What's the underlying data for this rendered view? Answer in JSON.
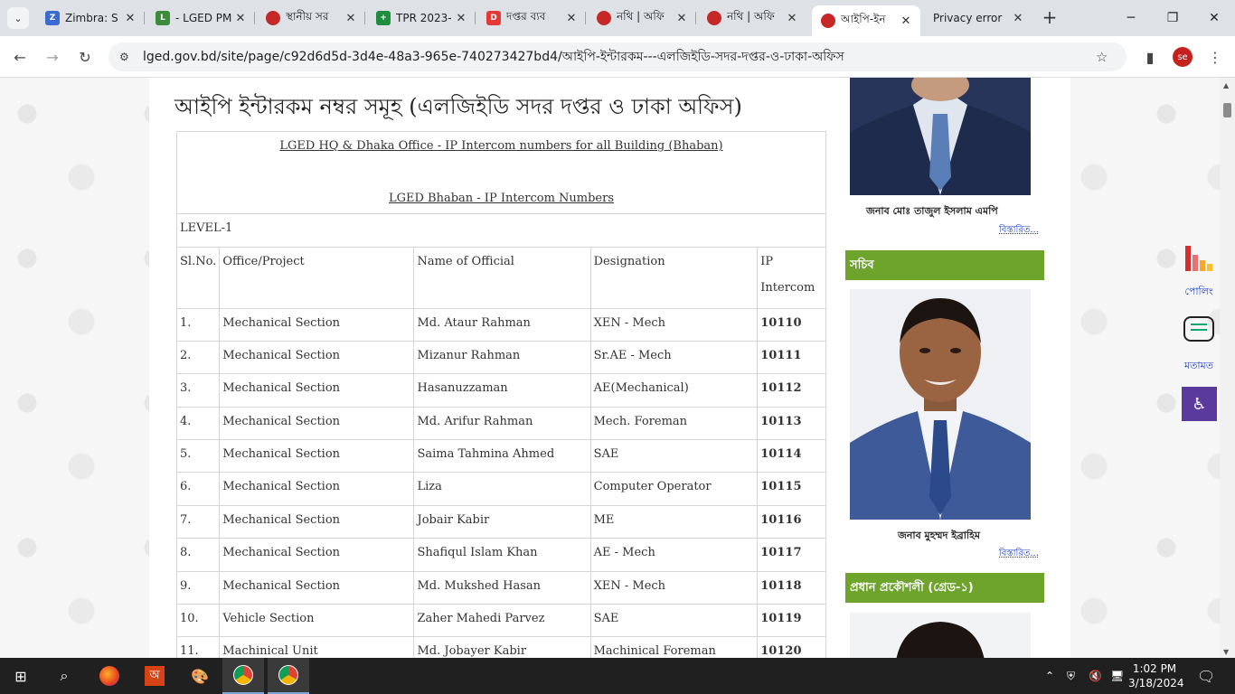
{
  "tabs": [
    {
      "title": "Zimbra: S",
      "fav_color": "#3b6bd1",
      "fav_text": "Z"
    },
    {
      "title": "- LGED PM",
      "fav_color": "#3b8d3b",
      "fav_text": "L"
    },
    {
      "title": "স্থানীয় সর",
      "fav_color": "#c62828",
      "fav_text": ""
    },
    {
      "title": "TPR 2023-",
      "fav_color": "#1e8e3e",
      "fav_text": "+"
    },
    {
      "title": "দপ্তর ব্যব",
      "fav_color": "#e53935",
      "fav_text": "D"
    },
    {
      "title": "নথি | অফি",
      "fav_color": "#c62828",
      "fav_text": ""
    },
    {
      "title": "নথি | অফি",
      "fav_color": "#c62828",
      "fav_text": ""
    },
    {
      "title": "আইপি-ইন",
      "fav_color": "#c62828",
      "fav_text": ""
    },
    {
      "title": "Privacy error",
      "fav_color": "",
      "fav_text": ""
    }
  ],
  "address": {
    "url": "lged.gov.bd/site/page/c92d6d5d-3d4e-48a3-965e-740273427bd4/আইপি-ইন্টারকম---এলজিইডি-সদর-দপ্তর-ও-ঢাকা-অফিস"
  },
  "profile": {
    "initials": "se"
  },
  "page": {
    "title": "আইপি ইন্টারকম নম্বর সমূহ (এলজিইডি সদর দপ্তর ও ঢাকা অফিস)",
    "caption1": "LGED HQ & Dhaka Office - IP Intercom numbers for all Building (Bhaban)",
    "caption2": "LGED Bhaban - IP Intercom Numbers",
    "level": "LEVEL-1",
    "headers": {
      "sl": "Sl.No.",
      "office": "Office/Project",
      "name": "Name of Official",
      "designation": "Designation",
      "ip": "IP Intercom"
    },
    "rows": [
      {
        "sl": "1.",
        "office": "Mechanical Section",
        "name": "Md. Ataur Rahman",
        "designation": "XEN - Mech",
        "ip": "10110"
      },
      {
        "sl": "2.",
        "office": "Mechanical Section",
        "name": "Mizanur Rahman",
        "designation": "Sr.AE - Mech",
        "ip": "10111"
      },
      {
        "sl": "3.",
        "office": "Mechanical Section",
        "name": "Hasanuzzaman",
        "designation": "AE(Mechanical)",
        "ip": "10112"
      },
      {
        "sl": "4.",
        "office": "Mechanical Section",
        "name": "Md. Arifur Rahman",
        "designation": "Mech. Foreman",
        "ip": "10113"
      },
      {
        "sl": "5.",
        "office": "Mechanical Section",
        "name": "Saima Tahmina Ahmed",
        "designation": "SAE",
        "ip": "10114"
      },
      {
        "sl": "6.",
        "office": "Mechanical Section",
        "name": "Liza",
        "designation": "Computer Operator",
        "ip": "10115"
      },
      {
        "sl": "7.",
        "office": "Mechanical Section",
        "name": "Jobair Kabir",
        "designation": "ME",
        "ip": "10116"
      },
      {
        "sl": "8.",
        "office": "Mechanical Section",
        "name": "Shafiqul Islam Khan",
        "designation": "AE - Mech",
        "ip": "10117"
      },
      {
        "sl": "9.",
        "office": "Mechanical Section",
        "name": "Md. Mukshed Hasan",
        "designation": "XEN - Mech",
        "ip": "10118"
      },
      {
        "sl": "10.",
        "office": "Vehicle Section",
        "name": "Zaher Mahedi Parvez",
        "designation": "SAE",
        "ip": "10119"
      },
      {
        "sl": "11.",
        "office": "Machinical Unit",
        "name": "Md. Jobayer Kabir",
        "designation": "Machinical Foreman",
        "ip": "10120"
      }
    ]
  },
  "sidebar": {
    "minister_name": "জনাব মোঃ তাজুল ইসলাম  এমপি",
    "more1": "বিস্তারিত...",
    "secretary_head": "সচিব",
    "secretary_name": "জনাব মুহম্মদ ইব্রাহিম",
    "more2": "বিস্তারিত...",
    "chief_head": "প্রধান প্রকৌশলী (গ্রেড-১)"
  },
  "widgets": {
    "poll": "পোলিং",
    "feedback": "মতামত"
  },
  "taskbar": {
    "time": "1:02 PM",
    "date": "3/18/2024"
  },
  "colors": {
    "section_green": "#6ea42b",
    "link_blue": "#1a3cc7",
    "accent_purple": "#5b3a9e"
  }
}
